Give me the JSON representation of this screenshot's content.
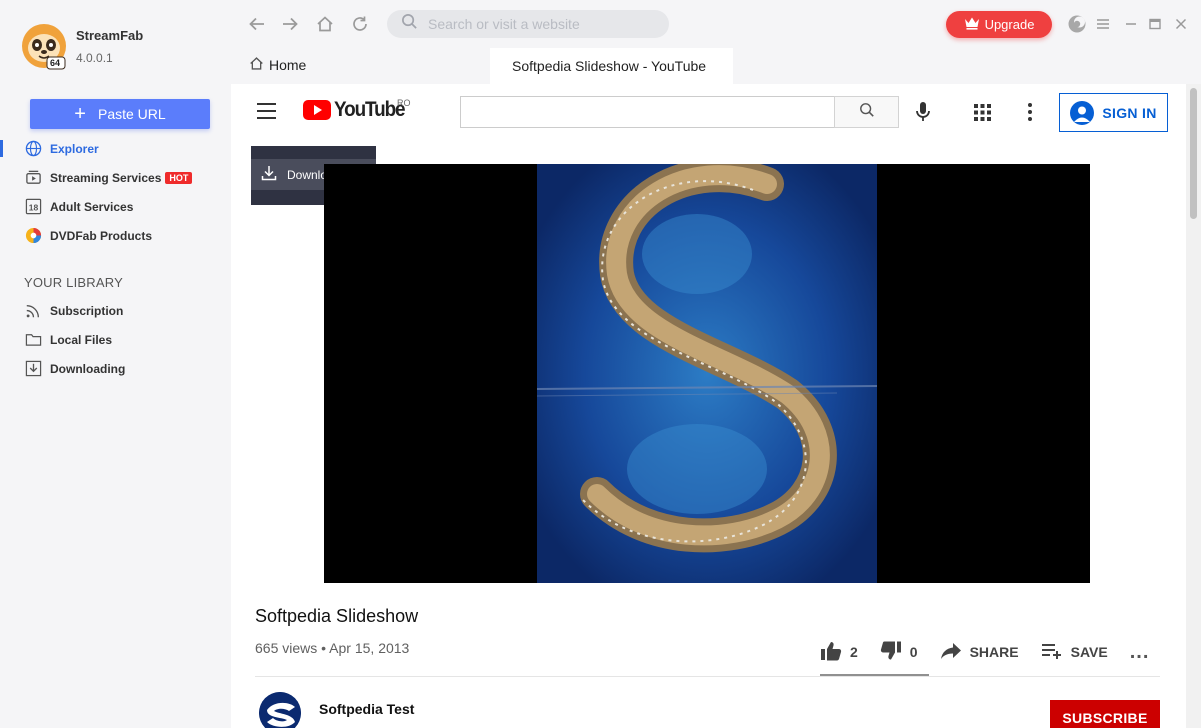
{
  "app": {
    "name": "StreamFab",
    "version": "4.0.0.1",
    "badge": "64"
  },
  "sidebar": {
    "paste_url": "Paste URL",
    "nav": [
      {
        "label": "Explorer",
        "icon": "globe-icon"
      },
      {
        "label": "Streaming Services",
        "icon": "play-stack-icon",
        "badge": "HOT"
      },
      {
        "label": "Adult Services",
        "icon": "adult-18-icon"
      },
      {
        "label": "DVDFab Products",
        "icon": "dvdfab-icon"
      }
    ],
    "library_title": "YOUR LIBRARY",
    "library": [
      {
        "label": "Subscription",
        "icon": "rss-icon"
      },
      {
        "label": "Local Files",
        "icon": "folder-icon"
      },
      {
        "label": "Downloading",
        "icon": "download-box-icon"
      }
    ]
  },
  "toolbar": {
    "search_placeholder": "Search or visit a website",
    "upgrade_label": "Upgrade"
  },
  "tabs": {
    "home": "Home",
    "active": "Softpedia Slideshow - YouTube"
  },
  "youtube": {
    "logo_text": "YouTube",
    "region": "RO",
    "signin": "SIGN IN",
    "download_label": "Download",
    "video": {
      "title": "Softpedia Slideshow",
      "meta": "665 views • Apr 15, 2013",
      "likes": "2",
      "dislikes": "0",
      "share": "SHARE",
      "save": "SAVE",
      "more": "..."
    },
    "channel": {
      "name": "Softpedia Test",
      "subscribe": "SUBSCRIBE"
    }
  },
  "colors": {
    "accent": "#5b7dfb",
    "active_nav": "#2d6ae0",
    "upgrade": "#ef4040",
    "hot": "#ef2b2b",
    "youtube_red": "#ff0000",
    "youtube_blue": "#065fd4",
    "subscribe": "#cc0000"
  }
}
